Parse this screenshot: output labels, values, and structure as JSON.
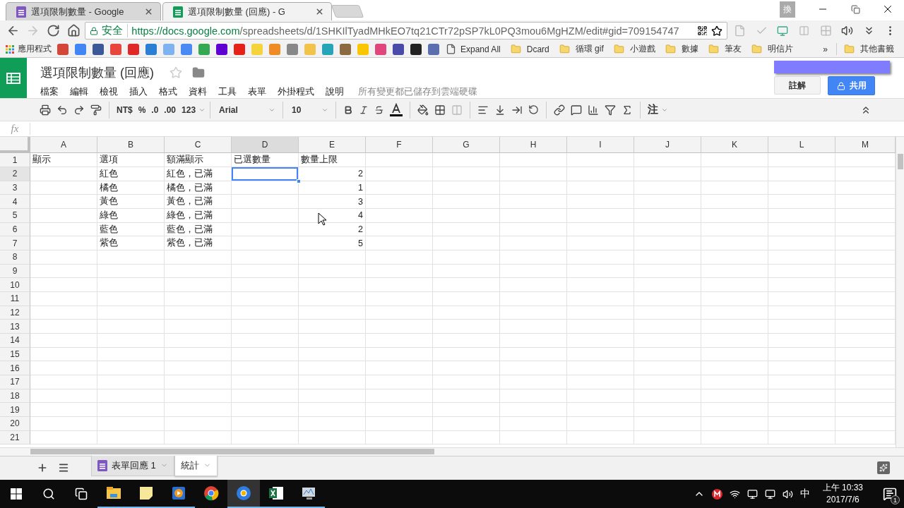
{
  "browser": {
    "tabs": [
      {
        "title": "選項限制數量 - Google",
        "kind": "forms",
        "selected": false
      },
      {
        "title": "選項限制數量 (回應) - G",
        "kind": "sheets",
        "selected": true
      }
    ],
    "ime_badge": "換",
    "nav": [
      {
        "kind": "back",
        "disabled": false
      },
      {
        "kind": "forward",
        "disabled": true
      },
      {
        "kind": "reload",
        "disabled": false
      },
      {
        "kind": "home",
        "disabled": false
      }
    ],
    "security_label": "安全",
    "url_host": "https://docs.google.com",
    "url_path": "/spreadsheets/d/1SHKIlTyadMHkEO7tq21CTr72pSP7kL0PQ3mou6MgHZM/edit#gid=709154747",
    "bookmarks": {
      "apps": "應用程式",
      "items": [
        {
          "label": "Expand All",
          "kind": "page"
        },
        {
          "label": "Dcard",
          "kind": "folder"
        },
        {
          "label": "循環 gif",
          "kind": "folder"
        },
        {
          "label": "小遊戲",
          "kind": "folder"
        },
        {
          "label": "數據",
          "kind": "folder"
        },
        {
          "label": "筆友",
          "kind": "folder"
        },
        {
          "label": "明信片",
          "kind": "folder"
        }
      ],
      "more": "»",
      "other": "其他書籤"
    }
  },
  "doc": {
    "title": "選項限制數量 (回應)",
    "menus": [
      "檔案",
      "編輯",
      "檢視",
      "插入",
      "格式",
      "資料",
      "工具",
      "表單",
      "外掛程式",
      "說明"
    ],
    "save_status": "所有變更都已儲存到雲端硬碟",
    "comment_button": "註解",
    "share_button": "共用"
  },
  "toolbar": {
    "currency": "NT$",
    "percent": "%",
    "decrease_decimals": ".0",
    "increase_decimals": ".00",
    "more_formats": "123",
    "font": "Arial",
    "font_size": "10",
    "input_tools": "注"
  },
  "formula_bar": {
    "label": "fx"
  },
  "grid": {
    "columns": [
      {
        "label": "A",
        "selected": false
      },
      {
        "label": "B",
        "selected": false
      },
      {
        "label": "C",
        "selected": false
      },
      {
        "label": "D",
        "selected": true
      },
      {
        "label": "E",
        "selected": false
      },
      {
        "label": "F",
        "selected": false
      },
      {
        "label": "G",
        "selected": false
      },
      {
        "label": "H",
        "selected": false
      },
      {
        "label": "I",
        "selected": false
      },
      {
        "label": "J",
        "selected": false
      },
      {
        "label": "K",
        "selected": false
      },
      {
        "label": "L",
        "selected": false
      },
      {
        "label": "M",
        "selected": false
      }
    ],
    "rows": [
      {
        "number": "1",
        "selected": false,
        "cells": [
          {
            "text": "顯示",
            "kind": "text"
          },
          {
            "text": "選項",
            "kind": "text"
          },
          {
            "text": "額滿顯示",
            "kind": "text"
          },
          {
            "text": "已選數量",
            "kind": "text"
          },
          {
            "text": "數量上限",
            "kind": "text"
          }
        ]
      },
      {
        "number": "2",
        "selected": true,
        "cells": [
          {
            "kind": "empty"
          },
          {
            "text": "紅色",
            "kind": "text"
          },
          {
            "text": "紅色，已滿",
            "kind": "text"
          },
          {
            "kind": "empty"
          },
          {
            "text": "2",
            "kind": "number"
          }
        ]
      },
      {
        "number": "3",
        "selected": false,
        "cells": [
          {
            "kind": "empty"
          },
          {
            "text": "橘色",
            "kind": "text"
          },
          {
            "text": "橘色，已滿",
            "kind": "text"
          },
          {
            "kind": "empty"
          },
          {
            "text": "1",
            "kind": "number"
          }
        ]
      },
      {
        "number": "4",
        "selected": false,
        "cells": [
          {
            "kind": "empty"
          },
          {
            "text": "黃色",
            "kind": "text"
          },
          {
            "text": "黃色，已滿",
            "kind": "text"
          },
          {
            "kind": "empty"
          },
          {
            "text": "3",
            "kind": "number"
          }
        ]
      },
      {
        "number": "5",
        "selected": false,
        "cells": [
          {
            "kind": "empty"
          },
          {
            "text": "綠色",
            "kind": "text"
          },
          {
            "text": "綠色，已滿",
            "kind": "text"
          },
          {
            "kind": "empty"
          },
          {
            "text": "4",
            "kind": "number"
          }
        ]
      },
      {
        "number": "6",
        "selected": false,
        "cells": [
          {
            "kind": "empty"
          },
          {
            "text": "藍色",
            "kind": "text"
          },
          {
            "text": "藍色，已滿",
            "kind": "text"
          },
          {
            "kind": "empty"
          },
          {
            "text": "2",
            "kind": "number"
          }
        ]
      },
      {
        "number": "7",
        "selected": false,
        "cells": [
          {
            "kind": "empty"
          },
          {
            "text": "紫色",
            "kind": "text"
          },
          {
            "text": "紫色，已滿",
            "kind": "text"
          },
          {
            "kind": "empty"
          },
          {
            "text": "5",
            "kind": "number"
          }
        ]
      },
      {
        "number": "8",
        "selected": false
      },
      {
        "number": "9",
        "selected": false
      },
      {
        "number": "10",
        "selected": false
      },
      {
        "number": "11",
        "selected": false
      },
      {
        "number": "12",
        "selected": false
      },
      {
        "number": "13",
        "selected": false
      },
      {
        "number": "14",
        "selected": false
      },
      {
        "number": "15",
        "selected": false
      },
      {
        "number": "16",
        "selected": false
      },
      {
        "number": "17",
        "selected": false
      },
      {
        "number": "18",
        "selected": false
      },
      {
        "number": "19",
        "selected": false
      },
      {
        "number": "20",
        "selected": false
      },
      {
        "number": "21",
        "selected": false
      }
    ]
  },
  "sheets": [
    {
      "label": "表單回應 1",
      "kind": "form",
      "selected": false
    },
    {
      "label": "統計",
      "kind": "plain",
      "selected": true
    }
  ],
  "taskbar": {
    "apps": [
      {
        "kind": "explorer",
        "running": true,
        "active": false
      },
      {
        "kind": "notes",
        "running": true,
        "active": false
      },
      {
        "kind": "media",
        "running": true,
        "active": false
      },
      {
        "kind": "chrome",
        "running": false,
        "active": false
      },
      {
        "kind": "canary",
        "running": true,
        "active": true
      },
      {
        "kind": "excel",
        "running": true,
        "active": false
      },
      {
        "kind": "monitor",
        "running": true,
        "active": false
      }
    ],
    "ime": "中",
    "time": "上午 10:33",
    "date": "2017/7/6",
    "notifications": "1"
  }
}
